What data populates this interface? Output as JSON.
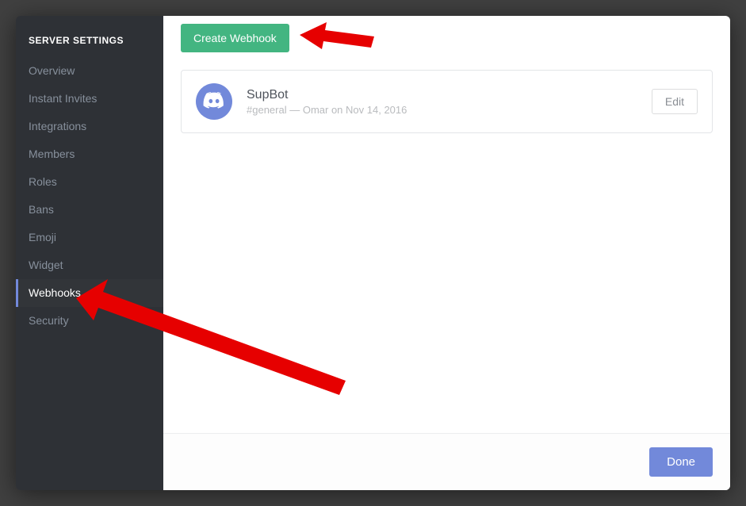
{
  "sidebar": {
    "header": "SERVER SETTINGS",
    "items": [
      {
        "label": "Overview",
        "active": false
      },
      {
        "label": "Instant Invites",
        "active": false
      },
      {
        "label": "Integrations",
        "active": false
      },
      {
        "label": "Members",
        "active": false
      },
      {
        "label": "Roles",
        "active": false
      },
      {
        "label": "Bans",
        "active": false
      },
      {
        "label": "Emoji",
        "active": false
      },
      {
        "label": "Widget",
        "active": false
      },
      {
        "label": "Webhooks",
        "active": true
      },
      {
        "label": "Security",
        "active": false
      }
    ]
  },
  "main": {
    "create_button": "Create Webhook",
    "webhook": {
      "name": "SupBot",
      "channel": "#general",
      "separator": " — ",
      "author_prefix": "Omar on ",
      "date": "Nov 14, 2016",
      "edit_label": "Edit"
    }
  },
  "footer": {
    "done_label": "Done"
  },
  "colors": {
    "accent_green": "#43b581",
    "accent_blurple": "#7289da",
    "sidebar_bg": "#2e3136"
  }
}
